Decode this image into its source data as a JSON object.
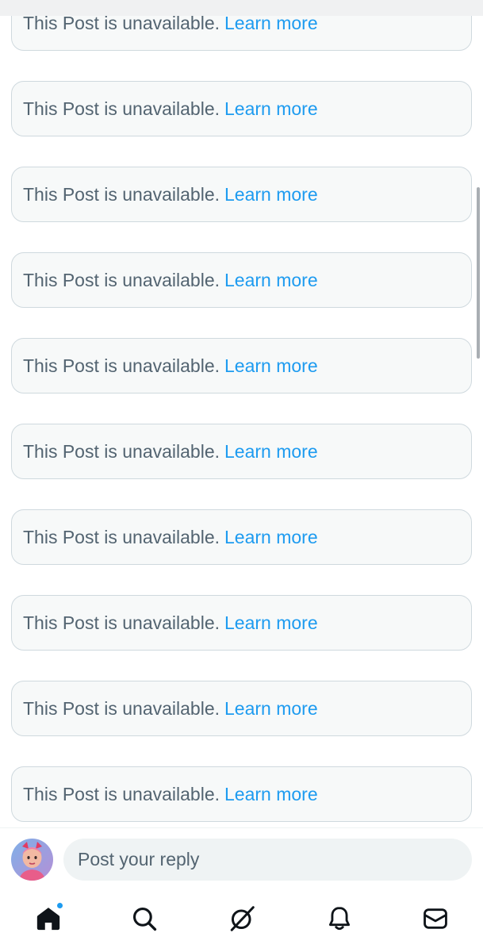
{
  "feed": {
    "items": [
      {
        "message": "This Post is unavailable.",
        "link": "Learn more"
      },
      {
        "message": "This Post is unavailable.",
        "link": "Learn more"
      },
      {
        "message": "This Post is unavailable.",
        "link": "Learn more"
      },
      {
        "message": "This Post is unavailable.",
        "link": "Learn more"
      },
      {
        "message": "This Post is unavailable.",
        "link": "Learn more"
      },
      {
        "message": "This Post is unavailable.",
        "link": "Learn more"
      },
      {
        "message": "This Post is unavailable.",
        "link": "Learn more"
      },
      {
        "message": "This Post is unavailable.",
        "link": "Learn more"
      },
      {
        "message": "This Post is unavailable.",
        "link": "Learn more"
      },
      {
        "message": "This Post is unavailable.",
        "link": "Learn more"
      }
    ]
  },
  "reply": {
    "placeholder": "Post your reply",
    "avatar_icon": "user-avatar"
  },
  "tabs": [
    {
      "name": "home-icon",
      "active": true,
      "has_notification_dot": true
    },
    {
      "name": "search-icon",
      "active": false
    },
    {
      "name": "grok-icon",
      "active": false
    },
    {
      "name": "bell-icon",
      "active": false
    },
    {
      "name": "mail-icon",
      "active": false
    }
  ],
  "colors": {
    "accent": "#1d9bf0",
    "text_secondary": "#536471",
    "card_bg": "#f7f9f9",
    "card_border": "#cfd9de"
  }
}
